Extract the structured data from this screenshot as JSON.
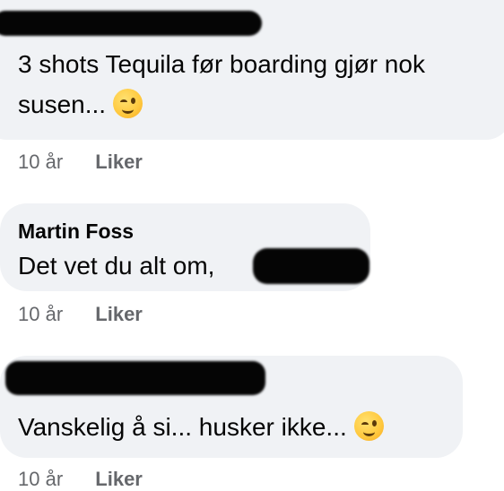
{
  "comments": [
    {
      "author": "",
      "text_line1": "3 shots Tequila før boarding gjør nok",
      "text_line2": "susen...",
      "emoji": "winking-face-emoji",
      "time": "10 år",
      "like_label": "Liker"
    },
    {
      "author": "Martin Foss",
      "text": "Det vet du alt om,",
      "time": "10 år",
      "like_label": "Liker"
    },
    {
      "author": "",
      "text": "Vanskelig å si... husker ikke...",
      "emoji": "winking-face-emoji",
      "time": "10 år",
      "like_label": "Liker"
    }
  ],
  "colors": {
    "bubble": "#f0f2f5",
    "text": "#050505",
    "meta": "#65676b",
    "emoji": "#ffc83d"
  }
}
